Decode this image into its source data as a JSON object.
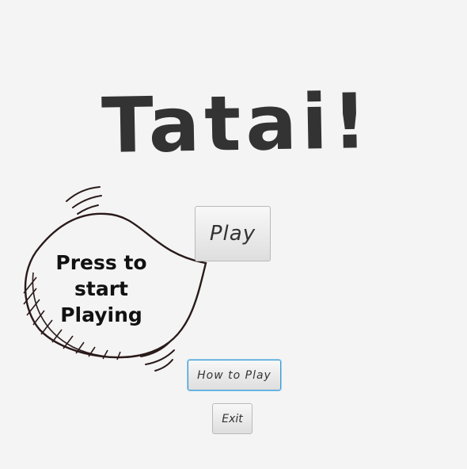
{
  "title": "Tatai!",
  "buttons": {
    "play": "Play",
    "how_to_play": "How to Play",
    "exit": "Exit"
  },
  "hint_bubble": {
    "line1": "Press to",
    "line2": "start",
    "line3": "Playing"
  },
  "colors": {
    "background": "#f4f4f4",
    "text": "#333333",
    "focus_ring": "#3a9bd5"
  }
}
